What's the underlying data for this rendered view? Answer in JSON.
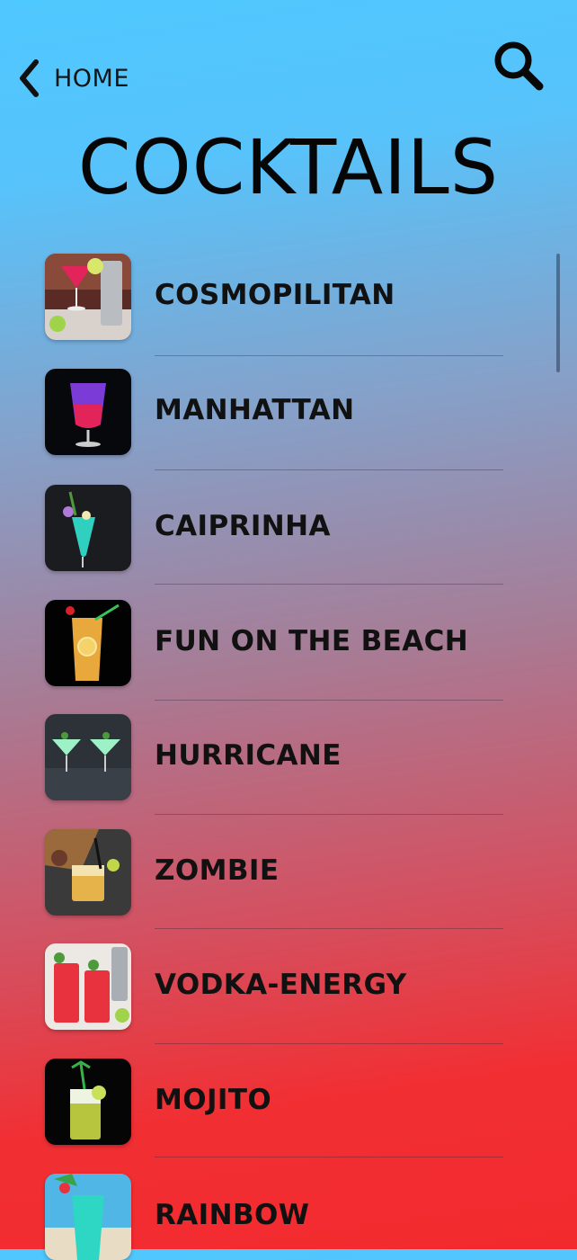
{
  "header": {
    "back_label": "HOME",
    "title": "COCKTAILS"
  },
  "icons": {
    "back": "chevron-left-icon",
    "search": "search-icon"
  },
  "cocktails": [
    {
      "name": "COSMOPILITAN"
    },
    {
      "name": "MANHATTAN"
    },
    {
      "name": "CAIPRINHA"
    },
    {
      "name": "FUN ON THE BEACH"
    },
    {
      "name": "HURRICANE"
    },
    {
      "name": "ZOMBIE"
    },
    {
      "name": "VODKA-ENERGY"
    },
    {
      "name": "MOJITO"
    },
    {
      "name": "RAINBOW"
    }
  ],
  "colors": {
    "gradient_top": "#4fc8ff",
    "gradient_bottom": "#f22a2e"
  }
}
